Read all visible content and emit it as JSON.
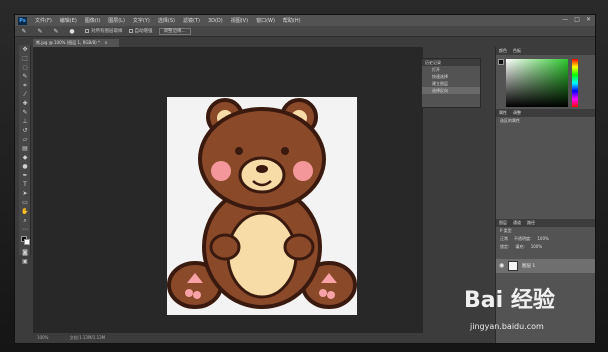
{
  "app": {
    "logo": "Ps"
  },
  "menubar": {
    "items": [
      "文件(F)",
      "编辑(E)",
      "图像(I)",
      "图层(L)",
      "文字(Y)",
      "选择(S)",
      "滤镜(T)",
      "3D(D)",
      "视图(V)",
      "窗口(W)",
      "帮助(H)"
    ],
    "window_controls": [
      "—",
      "□",
      "✕"
    ]
  },
  "options_bar": {
    "sample_all_layers": "对所有图层取样",
    "auto_enhance": "自动增强",
    "refine_edge": "调整边缘..."
  },
  "document": {
    "tab_title": "熊.jpg @ 100% (图层 1, RGB/8) *",
    "close": "×",
    "status_zoom": "100%",
    "status_doc": "文档:1.13M/1.13M"
  },
  "history_panel": {
    "title": "历史记录",
    "items": [
      "打开",
      "快速选择",
      "建立图层",
      "选择反向"
    ]
  },
  "right_column": {
    "color_tabs": [
      "颜色",
      "色板"
    ],
    "adj_tabs": [
      "属性",
      "调整"
    ],
    "adj_title": "选区的属性",
    "layer_tabs": [
      "图层",
      "通道",
      "路径"
    ],
    "kind_label": "P 类型",
    "blend_mode": "正常",
    "opacity_label": "不透明度:",
    "opacity_value": "100%",
    "lock_label": "锁定:",
    "fill_label": "填充:",
    "fill_value": "100%",
    "layer_name": "图层 1"
  },
  "watermark": {
    "brand": "Bai 经验",
    "url": "jingyan.baidu.com"
  },
  "colors": {
    "bear_fur": "#8a4a2a",
    "bear_outline": "#3a1a0e",
    "bear_belly": "#f8dca7",
    "bear_cheek": "#f4979a",
    "paw_pink": "#f7a2a6",
    "canvas_bg": "#f3f3f3"
  }
}
